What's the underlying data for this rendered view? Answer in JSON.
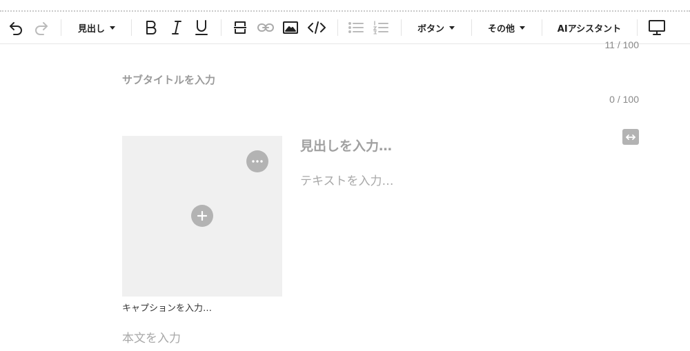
{
  "toolbar": {
    "undo_icon": "undo-icon",
    "redo_icon": "redo-icon",
    "heading_dropdown": "見出し",
    "bold_icon": "bold-icon",
    "italic_icon": "italic-icon",
    "underline_icon": "underline-icon",
    "strikethrough_icon": "strikethrough-icon",
    "link_icon": "link-icon",
    "image_icon": "image-icon",
    "code_icon": "code-icon",
    "bullet_list_icon": "bullet-list-icon",
    "numbered_list_icon": "numbered-list-icon",
    "button_dropdown": "ボタン",
    "other_dropdown": "その他",
    "ai_assistant": "AIアシスタント",
    "preview_icon": "monitor-icon"
  },
  "editor": {
    "title_counter": "11 / 100",
    "subtitle_placeholder": "サブタイトルを入力",
    "subtitle_counter": "0 / 100",
    "block": {
      "heading_placeholder": "見出しを入力…",
      "text_placeholder": "テキストを入力…",
      "caption_placeholder": "キャプションを入力…"
    },
    "body_placeholder": "本文を入力"
  },
  "colors": {
    "placeholder": "#a8a8a8",
    "image_bg": "#f0f0f0",
    "button_gray": "#b3b3b3",
    "toolbar_icon": "#222222",
    "toolbar_icon_disabled": "#bbbbbb"
  }
}
